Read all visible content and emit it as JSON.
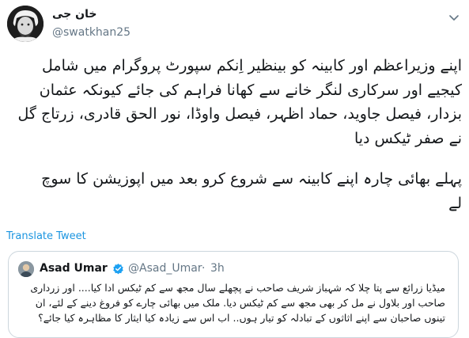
{
  "tweet": {
    "display_name": "خان جی",
    "handle": "@swatkhan25",
    "body_lines": [
      "اپنے وزیراعظم اور کابینہ کو بینظیر اِنکم سپورٹ پروگرام میں شامل",
      "کیجیے اور سرکاری لنگر خانے سے کھانا فراہم کی جائے کیونکہ عثمان",
      "بزدار، فیصل جاوید، حماد اظہر، فیصل واوڈا، نور الحق قادری، زرتاج گل",
      "نے صفر ٹیکس دیا"
    ],
    "body_lines_2": [
      "پہلے بھائی چارہ اپنے  کابینہ سے شروع کرو بعد میں اپوزیشن کا سوچ",
      "لے"
    ],
    "translate_label": "Translate Tweet"
  },
  "quoted": {
    "name": "Asad Umar",
    "handle": "@Asad_Umar",
    "separator": "·",
    "time": "3h",
    "lines": [
      "میڈیا زرائع سے پتا چلا کہ شہباز شریف صاحب نے پچھلے سال مجھ سے کم ٹیکس ادا کیا.... اور زرداری",
      "صاحب اور بلاول نے مل کر بھی مجھ سے کم ٹیکس دیا. ملک میں بھائی چارے کو فروغ دینے کے لئے، ان",
      "تینوں صاحبان سے اپنے اثاثوں کے تبادلہ کو تیار ہوں.. اب اس سے زیادہ کیا ایثار کا مظاہرہ کیا جائے؟"
    ]
  },
  "colors": {
    "link": "#1b95e0",
    "secondary_text": "#657786",
    "border": "#ccd6dd",
    "verified": "#1da1f2"
  },
  "icons": {
    "caret": "chevron-down-icon",
    "verified": "verified-badge-icon"
  }
}
